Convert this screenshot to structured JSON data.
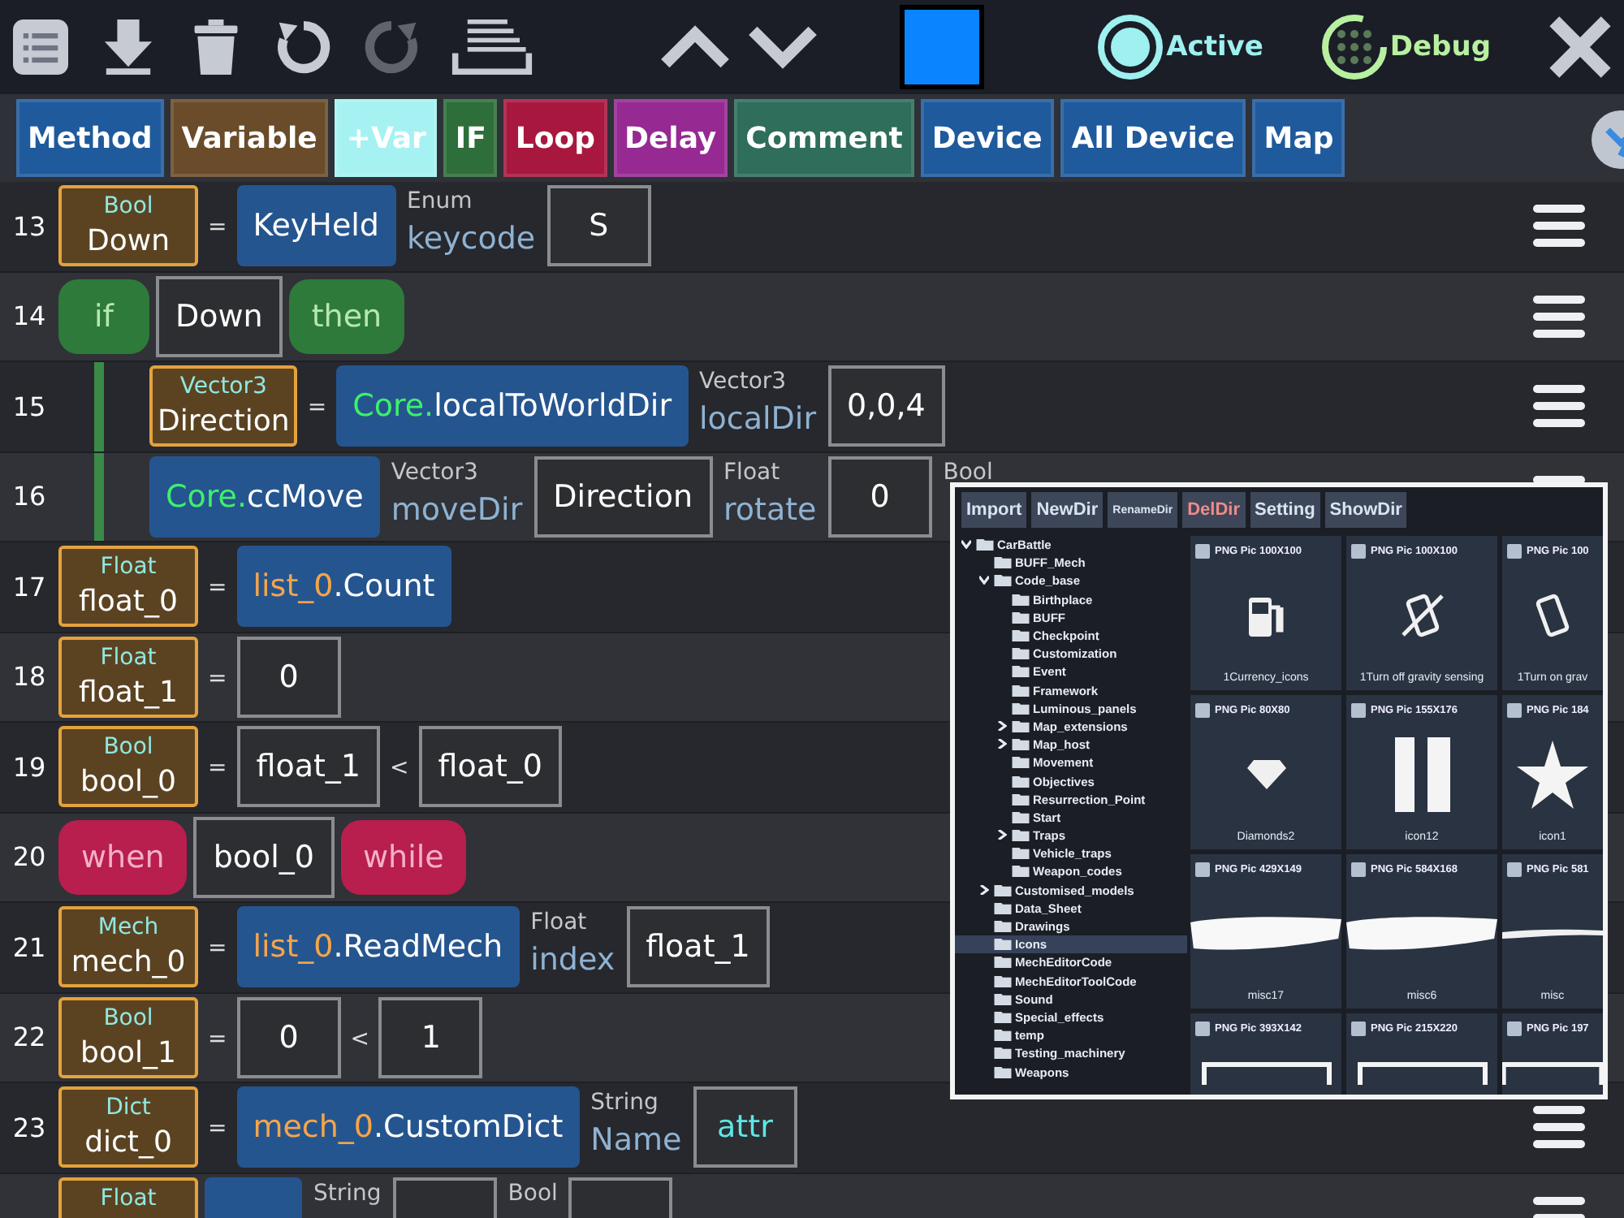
{
  "toolbar": {
    "redo_disabled": true,
    "toggles": [
      {
        "label": "Active",
        "on": true,
        "color": "#9ff0f0"
      },
      {
        "label": "Debug",
        "on": false,
        "color": "#b8f0a0"
      }
    ]
  },
  "tabs": [
    {
      "label": "Method",
      "color": "#1f5a9c"
    },
    {
      "label": "Variable",
      "color": "#6a4c2a"
    },
    {
      "label": "+Var",
      "color": "#a6f2f2"
    },
    {
      "label": "IF",
      "color": "#2e6e3a"
    },
    {
      "label": "Loop",
      "color": "#a8183e"
    },
    {
      "label": "Delay",
      "color": "#962a92"
    },
    {
      "label": "Comment",
      "color": "#2e6e5a"
    },
    {
      "label": "Device",
      "color": "#1f5a9c"
    },
    {
      "label": "All Device",
      "color": "#1f5a9c"
    },
    {
      "label": "Map",
      "color": "#1f5a9c"
    }
  ],
  "rows": [
    {
      "line": "13",
      "menu": true,
      "tokens": [
        {
          "kind": "var",
          "type": "Bool",
          "name": "Down"
        },
        {
          "kind": "op",
          "text": "="
        },
        {
          "kind": "call",
          "method": "KeyHeld"
        },
        {
          "kind": "param",
          "type": "Enum",
          "name": "keycode"
        },
        {
          "kind": "value",
          "text": "S"
        }
      ]
    },
    {
      "line": "14",
      "menu": true,
      "tokens": [
        {
          "kind": "if",
          "text": "if"
        },
        {
          "kind": "value",
          "text": "Down"
        },
        {
          "kind": "if",
          "text": "then"
        }
      ],
      "children": [
        {
          "line": "15",
          "menu": true,
          "tokens": [
            {
              "kind": "var",
              "type": "Vector3",
              "name": "Direction"
            },
            {
              "kind": "op",
              "text": "="
            },
            {
              "kind": "call",
              "target": {
                "kind": "module",
                "text": "Core."
              },
              "method": "localToWorldDir"
            },
            {
              "kind": "param",
              "type": "Vector3",
              "name": "localDir"
            },
            {
              "kind": "value",
              "text": "0,0,4"
            }
          ]
        },
        {
          "line": "16",
          "menu": true,
          "tokens": [
            {
              "kind": "call",
              "target": {
                "kind": "module",
                "text": "Core."
              },
              "method": "ccMove"
            },
            {
              "kind": "param",
              "type": "Vector3",
              "name": "moveDir"
            },
            {
              "kind": "value",
              "text": "Direction"
            },
            {
              "kind": "param",
              "type": "Float",
              "name": "rotate"
            },
            {
              "kind": "value",
              "text": "0"
            },
            {
              "kind": "param",
              "type": "Bool"
            }
          ]
        }
      ]
    },
    {
      "line": "17",
      "menu": false,
      "tokens": [
        {
          "kind": "var",
          "type": "Float",
          "name": "float_0"
        },
        {
          "kind": "op",
          "text": "="
        },
        {
          "kind": "call",
          "target": {
            "kind": "variable",
            "text": "list_0"
          },
          "method": ".Count"
        }
      ]
    },
    {
      "line": "18",
      "menu": false,
      "tokens": [
        {
          "kind": "var",
          "type": "Float",
          "name": "float_1"
        },
        {
          "kind": "op",
          "text": "="
        },
        {
          "kind": "value",
          "text": "0"
        }
      ]
    },
    {
      "line": "19",
      "menu": false,
      "tokens": [
        {
          "kind": "var",
          "type": "Bool",
          "name": "bool_0"
        },
        {
          "kind": "op",
          "text": "="
        },
        {
          "kind": "value",
          "text": "float_1"
        },
        {
          "kind": "op",
          "text": "<"
        },
        {
          "kind": "value",
          "text": "float_0"
        }
      ]
    },
    {
      "line": "20",
      "menu": false,
      "tokens": [
        {
          "kind": "loop",
          "text": "when"
        },
        {
          "kind": "value",
          "text": "bool_0"
        },
        {
          "kind": "loop",
          "text": "while"
        }
      ]
    },
    {
      "line": "21",
      "menu": false,
      "tokens": [
        {
          "kind": "var",
          "type": "Mech",
          "name": "mech_0"
        },
        {
          "kind": "op",
          "text": "="
        },
        {
          "kind": "call",
          "target": {
            "kind": "variable",
            "text": "list_0"
          },
          "method": ".ReadMech"
        },
        {
          "kind": "param",
          "type": "Float",
          "name": "index"
        },
        {
          "kind": "value",
          "text": "float_1"
        }
      ]
    },
    {
      "line": "22",
      "menu": false,
      "tokens": [
        {
          "kind": "var",
          "type": "Bool",
          "name": "bool_1"
        },
        {
          "kind": "op",
          "text": "="
        },
        {
          "kind": "value",
          "text": "0"
        },
        {
          "kind": "op",
          "text": "<"
        },
        {
          "kind": "value",
          "text": "1"
        }
      ]
    },
    {
      "line": "23",
      "menu": true,
      "tokens": [
        {
          "kind": "var",
          "type": "Dict",
          "name": "dict_0"
        },
        {
          "kind": "op",
          "text": "="
        },
        {
          "kind": "call",
          "target": {
            "kind": "variable",
            "text": "mech_0"
          },
          "method": ".CustomDict"
        },
        {
          "kind": "param",
          "type": "String",
          "name": "Name"
        },
        {
          "kind": "string",
          "text": "attr"
        }
      ]
    },
    {
      "menu": true,
      "tokens": [
        {
          "kind": "var",
          "type": "Float"
        },
        {
          "kind": "call"
        },
        {
          "kind": "param",
          "type": "String"
        },
        {
          "kind": "value"
        },
        {
          "kind": "param",
          "type": "Bool"
        },
        {
          "kind": "value"
        }
      ]
    }
  ],
  "browser": {
    "buttons": [
      {
        "label": "Import",
        "kind": "normal"
      },
      {
        "label": "NewDir",
        "kind": "normal"
      },
      {
        "label": "RenameDir",
        "kind": "small"
      },
      {
        "label": "DelDir",
        "kind": "danger"
      },
      {
        "label": "Setting",
        "kind": "normal"
      },
      {
        "label": "ShowDir",
        "kind": "normal"
      }
    ],
    "tree": [
      {
        "name": "CarBattle",
        "expanded": true,
        "selected": false,
        "children": [
          {
            "name": "BUFF_Mech",
            "selected": false
          },
          {
            "name": "Code_base",
            "expanded": true,
            "selected": false,
            "children": [
              {
                "name": "Birthplace",
                "selected": false
              },
              {
                "name": "BUFF",
                "selected": false
              },
              {
                "name": "Checkpoint",
                "selected": false
              },
              {
                "name": "Customization",
                "selected": false
              },
              {
                "name": "Event",
                "selected": false
              },
              {
                "name": "Framework",
                "selected": false
              },
              {
                "name": "Luminous_panels",
                "selected": false
              },
              {
                "name": "Map_extensions",
                "expanded": false,
                "selected": false
              },
              {
                "name": "Map_host",
                "expanded": false,
                "selected": false
              },
              {
                "name": "Movement",
                "selected": false
              },
              {
                "name": "Objectives",
                "selected": false
              },
              {
                "name": "Resurrection_Point",
                "selected": false
              },
              {
                "name": "Start",
                "selected": false
              },
              {
                "name": "Traps",
                "expanded": false,
                "selected": false
              },
              {
                "name": "Vehicle_traps",
                "selected": false
              },
              {
                "name": "Weapon_codes",
                "selected": false
              }
            ]
          },
          {
            "name": "Customised_models",
            "expanded": false,
            "selected": false
          },
          {
            "name": "Data_Sheet",
            "selected": false
          },
          {
            "name": "Drawings",
            "selected": false
          },
          {
            "name": "Icons",
            "selected": true
          },
          {
            "name": "MechEditorCode",
            "selected": false
          },
          {
            "name": "MechEditorToolCode",
            "selected": false
          },
          {
            "name": "Sound",
            "selected": false
          },
          {
            "name": "Special_effects",
            "selected": false
          },
          {
            "name": "temp",
            "selected": false
          },
          {
            "name": "Testing_machinery",
            "selected": false
          },
          {
            "name": "Weapons",
            "selected": false
          }
        ]
      }
    ],
    "assets": [
      {
        "caption": "PNG Pic 100X100",
        "name": "1Currency_icons",
        "thumb": {
          "kind": "fuel"
        },
        "checked": false
      },
      {
        "caption": "PNG Pic 100X100",
        "name": "1Turn off gravity sensing",
        "thumb": {
          "kind": "phone-off"
        },
        "checked": false
      },
      {
        "caption": "PNG Pic 100",
        "name": "1Turn on grav",
        "thumb": {
          "kind": "phone"
        },
        "checked": false
      },
      {
        "caption": "PNG Pic 80X80",
        "name": "Diamonds2",
        "thumb": {
          "kind": "diamond"
        },
        "checked": false
      },
      {
        "caption": "PNG Pic 155X176",
        "name": "icon12",
        "thumb": {
          "kind": "bars"
        },
        "checked": false
      },
      {
        "caption": "PNG Pic 184",
        "name": "icon1",
        "thumb": {
          "kind": "star"
        },
        "checked": false
      },
      {
        "caption": "PNG Pic 429X149",
        "name": "misc17",
        "thumb": {
          "kind": "stroke"
        },
        "checked": false
      },
      {
        "caption": "PNG Pic 584X168",
        "name": "misc6",
        "thumb": {
          "kind": "stroke"
        },
        "checked": false
      },
      {
        "caption": "PNG Pic 581",
        "name": "misc",
        "thumb": {
          "kind": "line"
        },
        "checked": false
      },
      {
        "caption": "PNG Pic 393X142",
        "thumb": {
          "kind": "frame"
        },
        "checked": false
      },
      {
        "caption": "PNG Pic 215X220",
        "thumb": {
          "kind": "frame"
        },
        "checked": false
      },
      {
        "caption": "PNG Pic 197",
        "thumb": {
          "kind": "frame"
        },
        "checked": false
      }
    ]
  }
}
